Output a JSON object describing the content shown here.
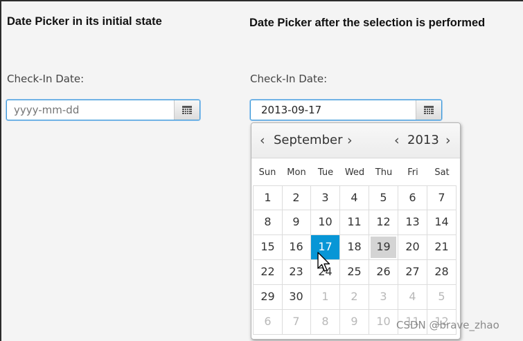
{
  "left_panel": {
    "heading": "Date  Picker in its initial state",
    "label": "Check-In Date:",
    "placeholder": "yyyy-mm-dd"
  },
  "right_panel": {
    "heading": "Date  Picker after the selection is performed",
    "label": "Check-In Date:",
    "value": "2013-09-17"
  },
  "calendar": {
    "month": "September",
    "year": "2013",
    "prev_glyph": "‹",
    "next_glyph": "›",
    "weekdays": [
      "Sun",
      "Mon",
      "Tue",
      "Wed",
      "Thu",
      "Fri",
      "Sat"
    ],
    "weeks": [
      [
        "1",
        "2",
        "3",
        "4",
        "5",
        "6",
        "7"
      ],
      [
        "8",
        "9",
        "10",
        "11",
        "12",
        "13",
        "14"
      ],
      [
        "15",
        "16",
        "17",
        "18",
        "19",
        "20",
        "21"
      ],
      [
        "22",
        "23",
        "24",
        "25",
        "26",
        "27",
        "28"
      ],
      [
        "29",
        "30",
        "1",
        "2",
        "3",
        "4",
        "5"
      ],
      [
        "6",
        "7",
        "8",
        "9",
        "10",
        "11",
        "12"
      ]
    ],
    "selected_day": "17",
    "today_day": "19"
  },
  "icons": {
    "calendar_button": "calendar-grid-icon",
    "pointer": "mouse-cursor-icon"
  },
  "colors": {
    "accent": "#0796d6",
    "focus_border": "#3e9ad8",
    "today_bg": "#d4d4d4"
  },
  "watermark": "CSDN @brave_zhao"
}
